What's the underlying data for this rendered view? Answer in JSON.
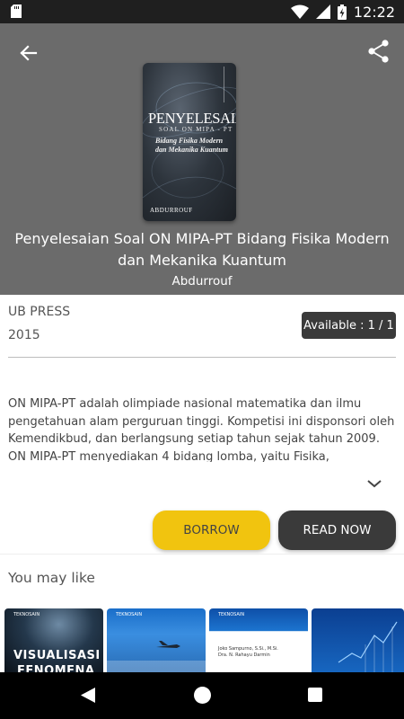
{
  "status_bar": {
    "time": "12:22",
    "icons": [
      "sd-card-icon",
      "wifi-icon",
      "signal-icon",
      "battery-charging-icon"
    ]
  },
  "header": {
    "back_icon": "arrow-left-icon",
    "share_icon": "share-icon",
    "cover": {
      "title": "PENYELESAIAN",
      "subtitle": "SOAL ON MIPA - PT",
      "subtitle2": "Bidang Fisika Modern dan Mekanika Kuantum",
      "author": "ABDURROUF"
    },
    "book_title": "Penyelesaian Soal ON MIPA-PT Bidang Fisika Modern dan Mekanika Kuantum",
    "author": "Abdurrouf"
  },
  "details": {
    "publisher": "UB PRESS",
    "year": "2015",
    "availability": "Available : 1 / 1",
    "description": "ON MIPA-PT adalah olimpiade nasional matematika dan ilmu pengetahuan alam perguruan tinggi. Kompetisi ini disponsori oleh Kemendikbud, dan berlangsung setiap tahun sejak tahun 2009. ON MIPA-PT menyediakan 4 bidang lomba, yaitu Fisika,",
    "expand_icon": "chevron-down-icon"
  },
  "actions": {
    "borrow_label": "BORROW",
    "read_label": "READ NOW"
  },
  "recommendations": {
    "heading": "You may like",
    "items": [
      {
        "tag": "TEKNOSAIN",
        "line1": "VISUALISASI",
        "line2": "FENOMENA"
      },
      {
        "tag": "TEKNOSAIN"
      },
      {
        "tag": "TEKNOSAIN",
        "authors": "Joko Sampurno, S.Si., M.Si.\nDra. N. Rahayu Darmin"
      },
      {
        "tag": ""
      }
    ]
  },
  "colors": {
    "header_bg": "#6b6b6b",
    "borrow_accent": "#f1c40f",
    "dark_button": "#3a3a3a"
  }
}
